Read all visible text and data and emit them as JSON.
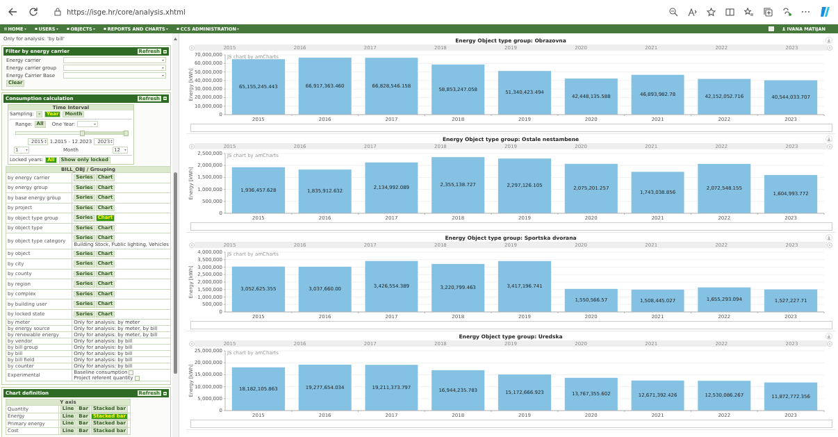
{
  "browser": {
    "url": "https://isge.hr/core/analysis.xhtml"
  },
  "nav": {
    "menus": [
      "HOME",
      "USERS",
      "OBJECTS",
      "REPORTS AND CHARTS",
      "CCS ADMINISTRATION"
    ],
    "user": "IVANA MATIJAN"
  },
  "sidebar": {
    "top_note": "Only for analysis: 'by bill'",
    "filter": {
      "title": "Filter by energy carrier",
      "refresh": "Refresh",
      "fields": [
        {
          "label": "Energy carrier"
        },
        {
          "label": "Energy carrier group"
        },
        {
          "label": "Energy Carrier Base"
        }
      ],
      "clear": "Clear"
    },
    "consumption": {
      "title": "Consumption calculation",
      "refresh": "Refresh",
      "time_interval": {
        "title": "Time Interval",
        "sampling_label": "Sampling:",
        "sampling_options": [
          {
            "label": "-",
            "selected": false
          },
          {
            "label": "Year",
            "selected": true
          },
          {
            "label": "Month",
            "selected": false
          }
        ],
        "range_label": "Range:",
        "range_button": "All",
        "one_year_label": "One Year:",
        "slider": {
          "level": 0.6
        },
        "from_year": "2015",
        "period": "1.2015 - 12.2023",
        "to_year": "2023",
        "from_month": "1",
        "month_label": "Month",
        "to_month": "12",
        "locked_label": "Locked years:",
        "locked_options": [
          {
            "label": "All",
            "selected": true
          },
          {
            "label": "Show only locked",
            "selected": false
          }
        ]
      },
      "grouping": {
        "title": "BILL_OBJ / Grouping",
        "rows": [
          {
            "label": "by energy carrier",
            "kind": "buttons",
            "options": [
              {
                "label": "Series",
                "selected": false
              },
              {
                "label": "Chart",
                "selected": false
              }
            ]
          },
          {
            "label": "by energy group",
            "kind": "buttons",
            "options": [
              {
                "label": "Series",
                "selected": false
              },
              {
                "label": "Chart",
                "selected": false
              }
            ]
          },
          {
            "label": "by base energy group",
            "kind": "buttons",
            "options": [
              {
                "label": "Series",
                "selected": false
              },
              {
                "label": "Chart",
                "selected": false
              }
            ]
          },
          {
            "label": "by project",
            "kind": "buttons",
            "options": [
              {
                "label": "Series",
                "selected": false
              },
              {
                "label": "Chart",
                "selected": false
              }
            ]
          },
          {
            "label": "by object type group",
            "kind": "buttons",
            "options": [
              {
                "label": "Series",
                "selected": false
              },
              {
                "label": "Chart",
                "selected": true
              }
            ]
          },
          {
            "label": "by object type",
            "kind": "buttons",
            "options": [
              {
                "label": "Series",
                "selected": false
              },
              {
                "label": "Chart",
                "selected": false
              }
            ]
          },
          {
            "label": "by object type category",
            "kind": "buttons",
            "options": [
              {
                "label": "Series",
                "selected": false
              },
              {
                "label": "Chart",
                "selected": false
              }
            ],
            "note": "Building Stock, Public lighting, Vehicles"
          },
          {
            "label": "by object",
            "kind": "buttons",
            "options": [
              {
                "label": "Series",
                "selected": false
              },
              {
                "label": "Chart",
                "selected": false
              }
            ]
          },
          {
            "label": "by city",
            "kind": "buttons",
            "options": [
              {
                "label": "Series",
                "selected": false
              },
              {
                "label": "Chart",
                "selected": false
              }
            ]
          },
          {
            "label": "by county",
            "kind": "buttons",
            "options": [
              {
                "label": "Series",
                "selected": false
              },
              {
                "label": "Chart",
                "selected": false
              }
            ]
          },
          {
            "label": "by region",
            "kind": "buttons",
            "options": [
              {
                "label": "Series",
                "selected": false
              },
              {
                "label": "Chart",
                "selected": false
              }
            ]
          },
          {
            "label": "by complex",
            "kind": "buttons",
            "options": [
              {
                "label": "Series",
                "selected": false
              },
              {
                "label": "Chart",
                "selected": false
              }
            ]
          },
          {
            "label": "by building user",
            "kind": "buttons",
            "options": [
              {
                "label": "Series",
                "selected": false
              },
              {
                "label": "Chart",
                "selected": false
              }
            ]
          },
          {
            "label": "by locked state",
            "kind": "buttons",
            "options": [
              {
                "label": "Series",
                "selected": false
              },
              {
                "label": "Chart",
                "selected": false
              }
            ]
          },
          {
            "label": "by meter",
            "kind": "text",
            "text": "Only for analysis: by meter"
          },
          {
            "label": "by energy source",
            "kind": "text",
            "text": "Only for analysis: by meter, by bill"
          },
          {
            "label": "by renewable energy",
            "kind": "text",
            "text": "Only for analysis: by meter, by bill"
          },
          {
            "label": "by vendor",
            "kind": "text",
            "text": "Only for analysis: by bill"
          },
          {
            "label": "by bill group",
            "kind": "text",
            "text": "Only for analysis: by bill"
          },
          {
            "label": "by bill",
            "kind": "text",
            "text": "Only for analysis: by bill"
          },
          {
            "label": "by bill field",
            "kind": "text",
            "text": "Only for analysis: by bill"
          },
          {
            "label": "by counter",
            "kind": "text",
            "text": "Only for analysis: by bill"
          },
          {
            "label": "Experimental",
            "kind": "checks",
            "checks": [
              {
                "label": "Baseline consumption",
                "checked": false
              },
              {
                "label": "Project referent quantity",
                "checked": false
              }
            ]
          }
        ]
      }
    },
    "chart_definition": {
      "title": "Chart definition",
      "refresh": "Refresh",
      "y_axis": {
        "title": "Y axis",
        "rows": [
          {
            "label": "Quantity",
            "options": [
              {
                "label": "Line",
                "selected": false
              },
              {
                "label": "Bar",
                "selected": false
              },
              {
                "label": "Stacked bar",
                "selected": false
              }
            ]
          },
          {
            "label": "Energy",
            "options": [
              {
                "label": "Line",
                "selected": false
              },
              {
                "label": "Bar",
                "selected": false
              },
              {
                "label": "Stacked bar",
                "selected": true
              }
            ]
          },
          {
            "label": "Primary energy",
            "options": [
              {
                "label": "Line",
                "selected": false
              },
              {
                "label": "Bar",
                "selected": false
              },
              {
                "label": "Stacked bar",
                "selected": false
              }
            ]
          },
          {
            "label": "Cost",
            "options": [
              {
                "label": "Line",
                "selected": false
              },
              {
                "label": "Bar",
                "selected": false
              },
              {
                "label": "Stacked bar",
                "selected": false
              }
            ]
          }
        ]
      }
    }
  },
  "charts": [
    {
      "scroller_labels": [
        "2015",
        "2016",
        "2017",
        "2018",
        "2019",
        "2020",
        "2021",
        "2022",
        "2023"
      ],
      "credit": "JS chart by amCharts",
      "chart_data": {
        "type": "bar",
        "grid": true,
        "title": "Energy Object type group: Obrazovna",
        "ylabel": "Energy [kWh]",
        "categories": [
          "2015",
          "2016",
          "2017",
          "2018",
          "2019",
          "2020",
          "2021",
          "2022",
          "2023"
        ],
        "values": [
          65155245.443,
          66917363.46,
          66828546.158,
          58853247.058,
          51340423.494,
          42448135.588,
          46893982.78,
          42152052.716,
          40544033.707
        ],
        "value_labels": [
          "65,155,245.443",
          "66,917,363.460",
          "66,828,546.158",
          "58,853,247.058",
          "51,340,423.494",
          "42,448,135.588",
          "46,893,982.78",
          "42,152,052.716",
          "40,544,033.707"
        ],
        "ylim": [
          0,
          70000000
        ],
        "yticks": [
          {
            "value": 0,
            "label": "0"
          },
          {
            "value": 10000000,
            "label": "10,000,000"
          },
          {
            "value": 20000000,
            "label": "20,000,000"
          },
          {
            "value": 30000000,
            "label": "30,000,000"
          },
          {
            "value": 40000000,
            "label": "40,000,000"
          },
          {
            "value": 50000000,
            "label": "50,000,000"
          },
          {
            "value": 60000000,
            "label": "60,000,000"
          },
          {
            "value": 70000000,
            "label": "70,000,000"
          }
        ]
      }
    },
    {
      "scroller_labels": [
        "2015",
        "2016",
        "2017",
        "2018",
        "2019",
        "2020",
        "2021",
        "2022",
        "2023"
      ],
      "credit": "JS chart by amCharts",
      "chart_data": {
        "type": "bar",
        "grid": true,
        "title": "Energy Object type group: Ostale nestambene",
        "ylabel": "Energy [kWh]",
        "categories": [
          "2015",
          "2016",
          "2017",
          "2018",
          "2019",
          "2020",
          "2021",
          "2022",
          "2023"
        ],
        "values": [
          1936457.628,
          1835912.632,
          2134992.089,
          2355138.727,
          2297126.105,
          2075201.257,
          1743038.856,
          2072548.155,
          1604993.772
        ],
        "value_labels": [
          "1,936,457.628",
          "1,835,912.632",
          "2,134,992.089",
          "2,355,138.727",
          "2,297,126.105",
          "2,075,201.257",
          "1,743,038.856",
          "2,072,548.155",
          "1,604,993.772"
        ],
        "ylim": [
          0,
          2500000
        ],
        "yticks": [
          {
            "value": 0,
            "label": "0"
          },
          {
            "value": 500000,
            "label": "500,000"
          },
          {
            "value": 1000000,
            "label": "1,000,000"
          },
          {
            "value": 1500000,
            "label": "1,500,000"
          },
          {
            "value": 2000000,
            "label": "2,000,000"
          },
          {
            "value": 2500000,
            "label": "2,500,000"
          }
        ]
      }
    },
    {
      "scroller_labels": [
        "2015",
        "2016",
        "2017",
        "2018",
        "2019",
        "2020",
        "2021",
        "2022",
        "2023"
      ],
      "credit": "JS chart by amCharts",
      "chart_data": {
        "type": "bar",
        "grid": true,
        "title": "Energy Object type group: Sportska dvorana",
        "ylabel": "Energy [kWh]",
        "categories": [
          "2015",
          "2016",
          "2017",
          "2018",
          "2019",
          "2020",
          "2021",
          "2022",
          "2023"
        ],
        "values": [
          3052625.355,
          3037660.0,
          3426554.389,
          3220799.463,
          3417196.741,
          1550566.57,
          1508445.027,
          1655293.094,
          1527227.71
        ],
        "value_labels": [
          "3,052,625.355",
          "3,037,660.00",
          "3,426,554.389",
          "3,220,799.463",
          "3,417,196.741",
          "1,550,566.57",
          "1,508,445.027",
          "1,655,293.094",
          "1,527,227.71"
        ],
        "ylim": [
          0,
          4000000
        ],
        "yticks": [
          {
            "value": 0,
            "label": "0"
          },
          {
            "value": 500000,
            "label": "500,000"
          },
          {
            "value": 1000000,
            "label": "1,000,000"
          },
          {
            "value": 1500000,
            "label": "1,500,000"
          },
          {
            "value": 2000000,
            "label": "2,000,000"
          },
          {
            "value": 2500000,
            "label": "2,500,000"
          },
          {
            "value": 3000000,
            "label": "3,000,000"
          },
          {
            "value": 3500000,
            "label": "3,500,000"
          },
          {
            "value": 4000000,
            "label": "4,000,000"
          }
        ]
      }
    },
    {
      "scroller_labels": [
        "2015",
        "2016",
        "2017",
        "2018",
        "2019",
        "2020",
        "2021",
        "2022",
        "2023"
      ],
      "credit": "JS chart by amCharts",
      "chart_data": {
        "type": "bar",
        "grid": true,
        "title": "Energy Object type group: Uredska",
        "ylabel": "Energy [kWh]",
        "categories": [
          "2015",
          "2016",
          "2017",
          "2018",
          "2019",
          "2020",
          "2021",
          "2022",
          "2023"
        ],
        "values": [
          18182105.863,
          19277654.034,
          19211373.797,
          16944235.783,
          15172666.923,
          13767355.602,
          12671392.426,
          12530086.267,
          11872772.356
        ],
        "value_labels": [
          "18,182,105.863",
          "19,277,654.034",
          "19,211,373.797",
          "16,944,235.783",
          "15,172,666.923",
          "13,767,355.602",
          "12,671,392.426",
          "12,530,086.267",
          "11,872,772.356"
        ],
        "ylim": [
          0,
          25000000
        ],
        "yticks": [
          {
            "value": 0,
            "label": "0"
          },
          {
            "value": 5000000,
            "label": "5,000,000"
          },
          {
            "value": 10000000,
            "label": "10,000,000"
          },
          {
            "value": 15000000,
            "label": "15,000,000"
          },
          {
            "value": 20000000,
            "label": "20,000,000"
          },
          {
            "value": 25000000,
            "label": "25,000,000"
          }
        ]
      }
    }
  ]
}
